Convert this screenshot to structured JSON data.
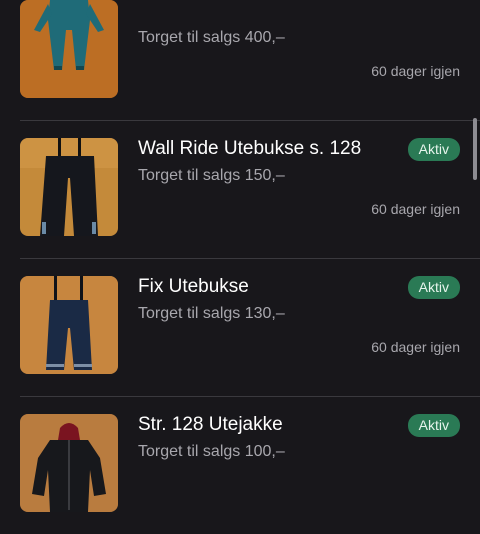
{
  "listings": [
    {
      "title": "",
      "price": "Torget til salgs 400,–",
      "days_left": "60 dager igjen",
      "image_icon": "snowsuit-photo"
    },
    {
      "title": "Wall Ride Utebukse s. 128",
      "price": "Torget til salgs 150,–",
      "status": "Aktiv",
      "days_left": "60 dager igjen",
      "image_icon": "snow-pants-photo"
    },
    {
      "title": "Fix Utebukse",
      "price": "Torget til salgs 130,–",
      "status": "Aktiv",
      "days_left": "60 dager igjen",
      "image_icon": "snow-pants-photo"
    },
    {
      "title": "Str. 128 Utejakke",
      "price": "Torget til salgs 100,–",
      "status": "Aktiv",
      "days_left": "",
      "image_icon": "jacket-photo"
    }
  ],
  "colors": {
    "background": "#18171b",
    "badge_bg": "#2a7a55",
    "secondary_text": "#a8a7ad",
    "divider": "#3a393e"
  }
}
